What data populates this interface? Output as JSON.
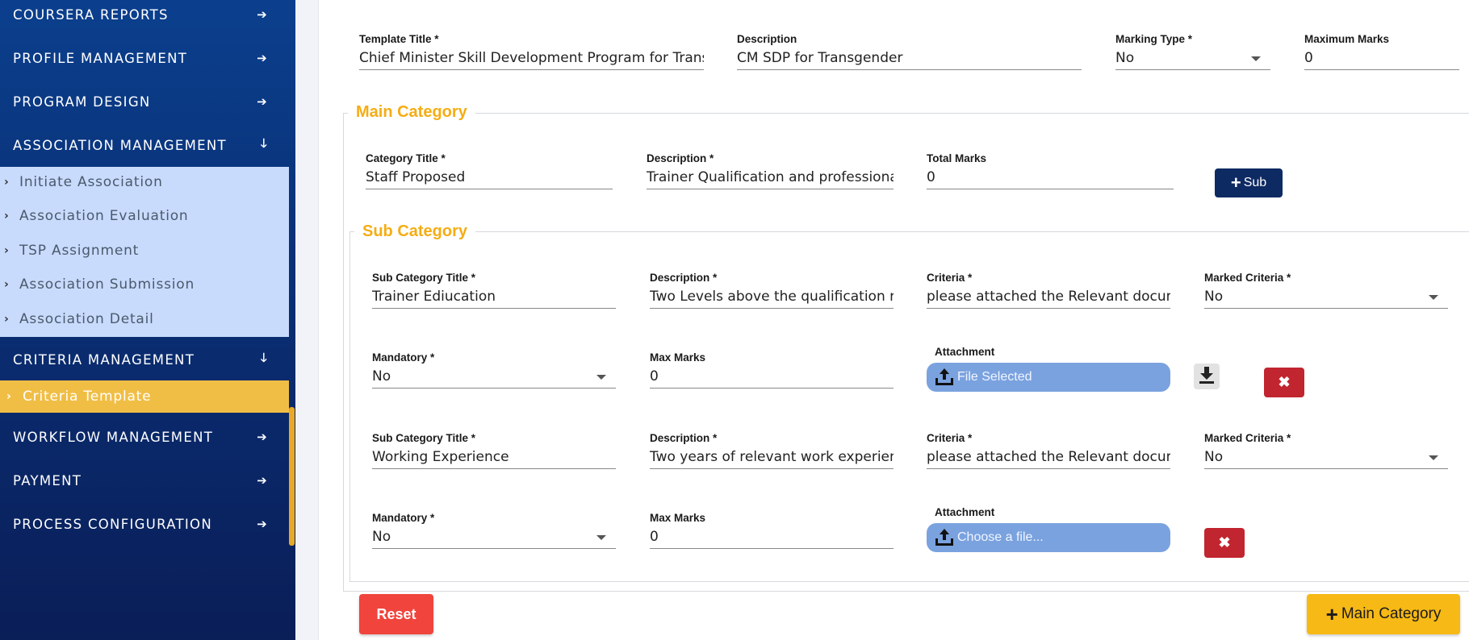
{
  "sidebar": {
    "items": [
      {
        "label": "COURSERA REPORTS",
        "arrow": "➔"
      },
      {
        "label": "PROFILE MANAGEMENT",
        "arrow": "➔"
      },
      {
        "label": "PROGRAM DESIGN",
        "arrow": "➔"
      },
      {
        "label": "ASSOCIATION MANAGEMENT",
        "arrow": "➔"
      },
      {
        "label": "CRITERIA MANAGEMENT",
        "arrow": "➔"
      },
      {
        "label": "WORKFLOW MANAGEMENT",
        "arrow": "➔"
      },
      {
        "label": "PAYMENT",
        "arrow": "➔"
      },
      {
        "label": "PROCESS CONFIGURATION",
        "arrow": "➔"
      }
    ],
    "association_sub": [
      {
        "label": "Initiate Association"
      },
      {
        "label": "Association Evaluation"
      },
      {
        "label": "TSP Assignment"
      },
      {
        "label": "Association Submission"
      },
      {
        "label": "Association Detail"
      }
    ],
    "criteria_sub": [
      {
        "label": "Criteria Template"
      }
    ],
    "down_arrow": "🡓"
  },
  "form": {
    "template_title": {
      "label": "Template Title *",
      "value": "Chief Minister Skill Development Program for Transgender"
    },
    "description": {
      "label": "Description",
      "value": " CM SDP for Transgender"
    },
    "marking_type": {
      "label": "Marking Type *",
      "value": "No"
    },
    "maximum_marks": {
      "label": "Maximum Marks",
      "value": "0"
    }
  },
  "main_category": {
    "legend": "Main Category",
    "category_title": {
      "label": "Category Title *",
      "value": "Staff Proposed"
    },
    "description": {
      "label": "Description *",
      "value": "Trainer Qualification  and professional"
    },
    "total_marks": {
      "label": "Total Marks",
      "value": "0"
    },
    "add_sub_label": "Sub"
  },
  "sub_category": {
    "legend": "Sub Category",
    "items": [
      {
        "title": {
          "label": "Sub Category Title *",
          "value": "Trainer Ediucation"
        },
        "description": {
          "label": "Description *",
          "value": "Two Levels above the qualification required"
        },
        "criteria": {
          "label": "Criteria *",
          "value": "please attached the Relevant documents"
        },
        "marked_criteria": {
          "label": "Marked Criteria *",
          "value": "No"
        },
        "mandatory": {
          "label": "Mandatory *",
          "value": "No"
        },
        "max_marks": {
          "label": "Max Marks",
          "value": "0"
        },
        "attachment": {
          "label": "Attachment",
          "text": "File Selected"
        }
      },
      {
        "title": {
          "label": "Sub Category Title *",
          "value": "Working Experience"
        },
        "description": {
          "label": "Description *",
          "value": "Two years of relevant work experience"
        },
        "criteria": {
          "label": "Criteria *",
          "value": "please attached the Relevant documents"
        },
        "marked_criteria": {
          "label": "Marked Criteria *",
          "value": "No"
        },
        "mandatory": {
          "label": "Mandatory *",
          "value": "No"
        },
        "max_marks": {
          "label": "Max Marks",
          "value": "0"
        },
        "attachment": {
          "label": "Attachment",
          "text": "Choose a file..."
        }
      }
    ]
  },
  "actions": {
    "reset_label": "Reset",
    "main_category_label": "Main Category"
  },
  "colors": {
    "sidebar_top": "#0b3f8d",
    "sidebar_bottom": "#0a1e58",
    "submenu_bg": "#c8dbfd",
    "active_item": "#f1be45",
    "legend": "#f5ad14",
    "sub_button": "#0e2a63",
    "delete_button": "#c1252f",
    "reset_button": "#f0443c",
    "main_button": "#f7b915",
    "file_input": "#7aa2df"
  }
}
